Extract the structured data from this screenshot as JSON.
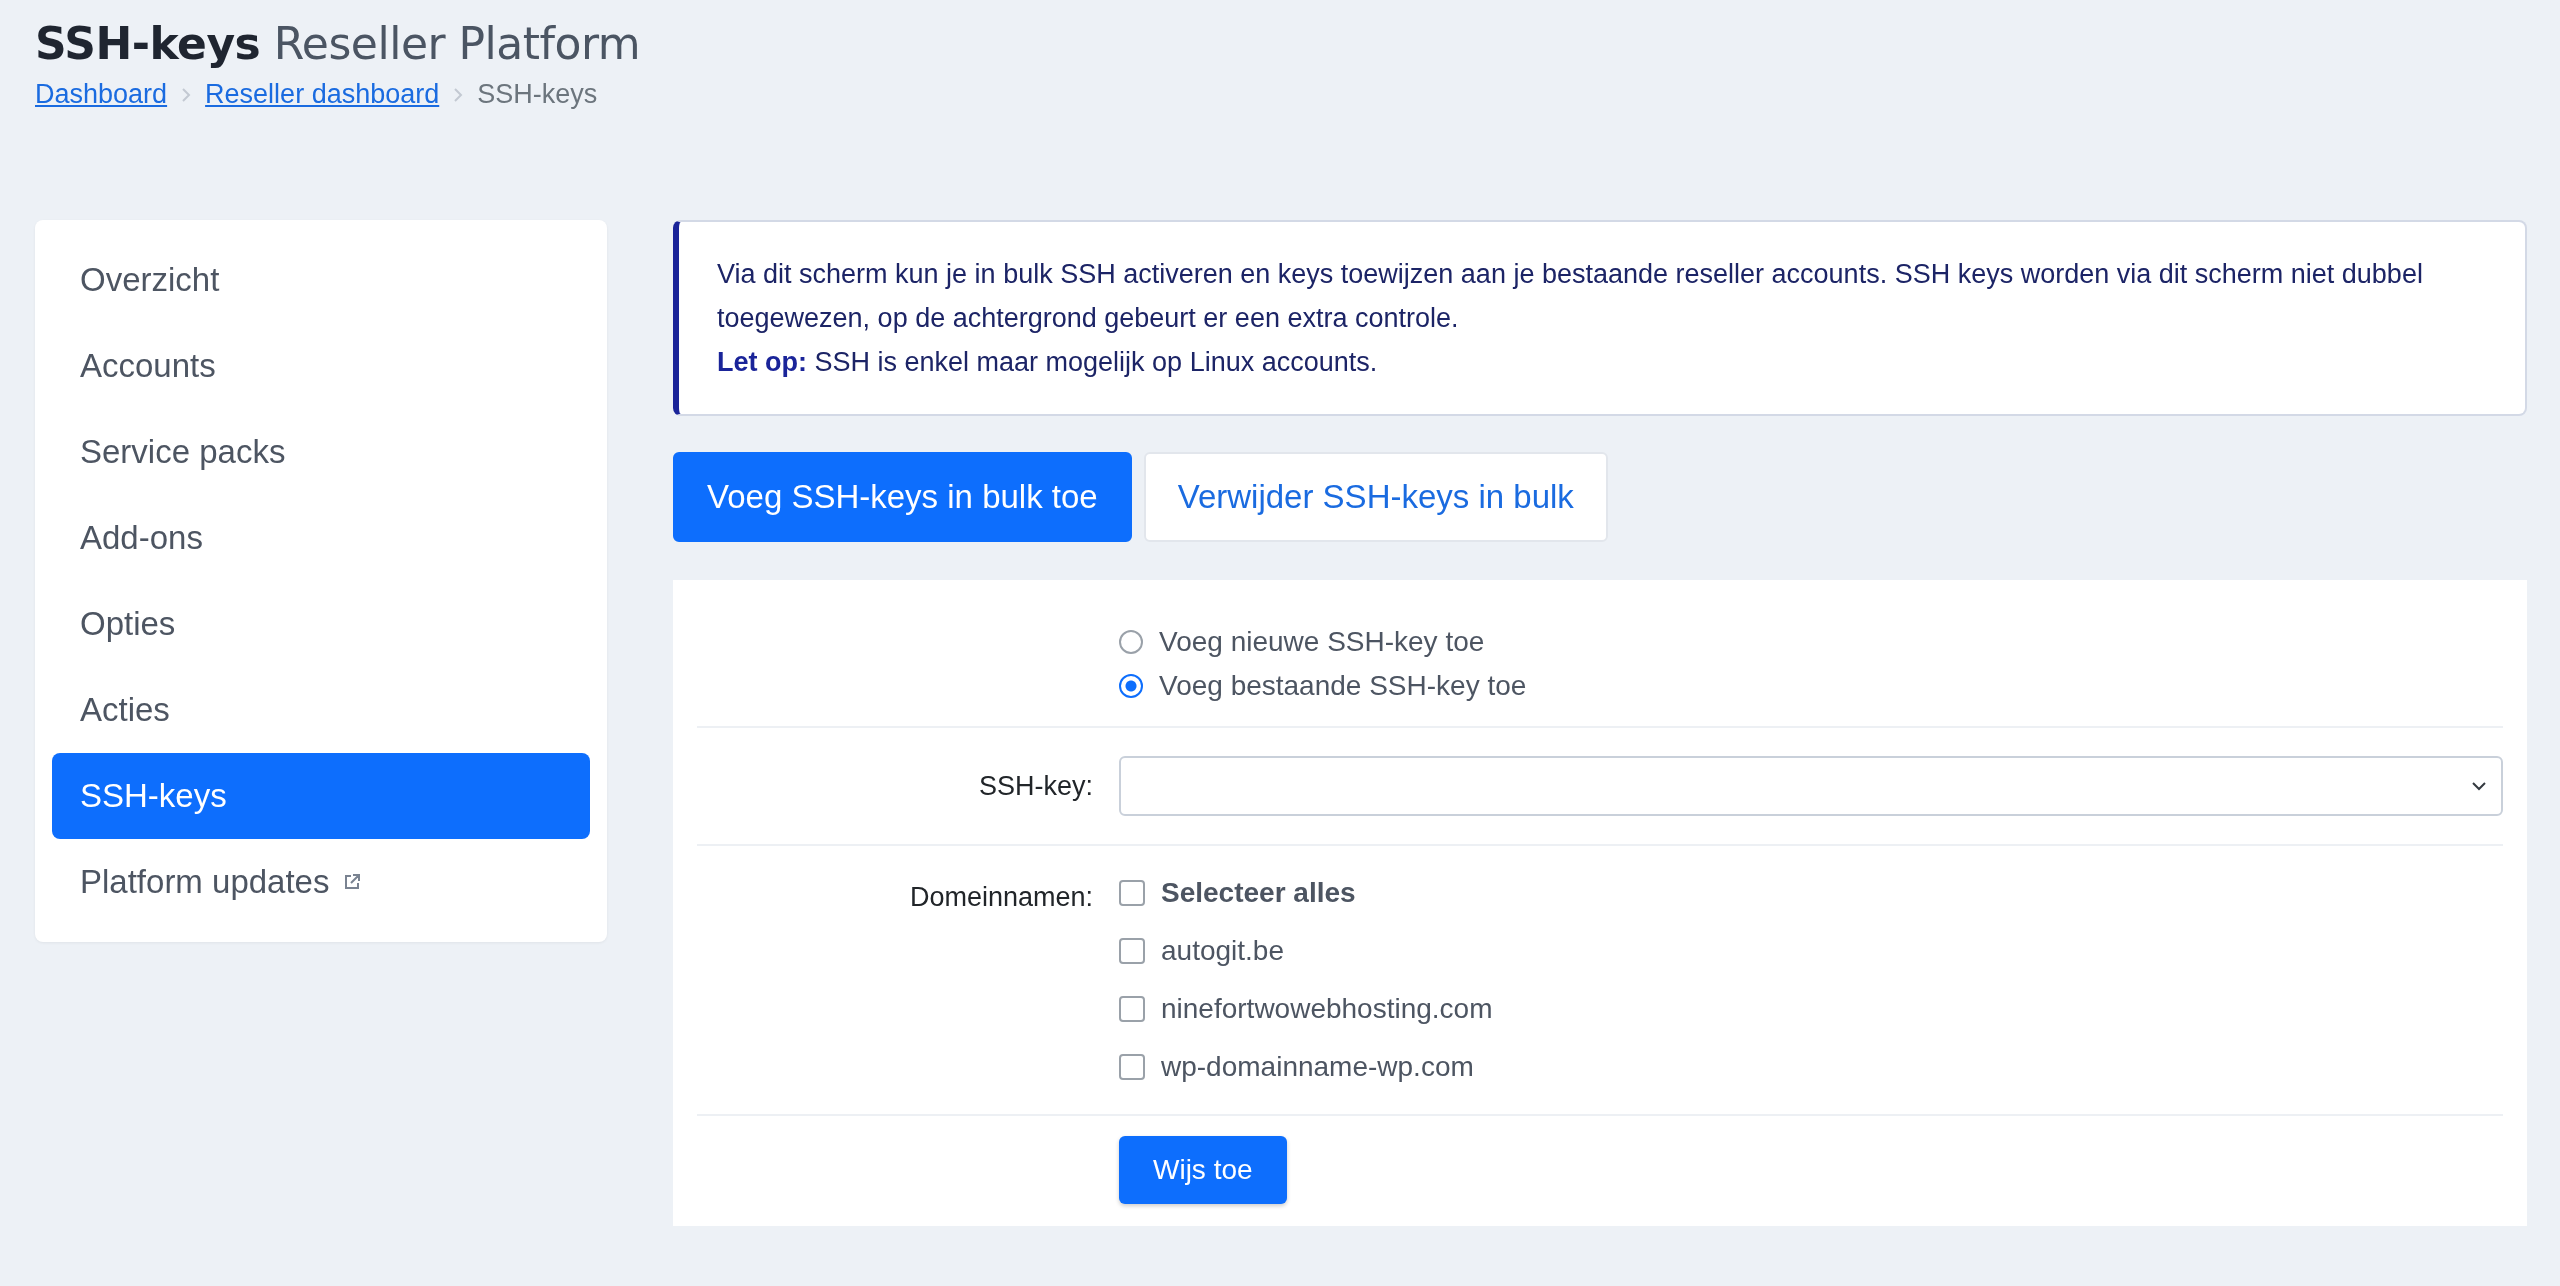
{
  "header": {
    "title_bold": "SSH-keys",
    "title_rest": "Reseller Platform"
  },
  "breadcrumb": [
    {
      "label": "Dashboard",
      "link": true
    },
    {
      "label": "Reseller dashboard",
      "link": true
    },
    {
      "label": "SSH-keys",
      "link": false
    }
  ],
  "sidebar": {
    "items": [
      {
        "label": "Overzicht",
        "selected": false,
        "external": false
      },
      {
        "label": "Accounts",
        "selected": false,
        "external": false
      },
      {
        "label": "Service packs",
        "selected": false,
        "external": false
      },
      {
        "label": "Add-ons",
        "selected": false,
        "external": false
      },
      {
        "label": "Opties",
        "selected": false,
        "external": false
      },
      {
        "label": "Acties",
        "selected": false,
        "external": false
      },
      {
        "label": "SSH-keys",
        "selected": true,
        "external": false
      },
      {
        "label": "Platform updates",
        "selected": false,
        "external": true
      }
    ]
  },
  "notice": {
    "text": "Via dit scherm kun je in bulk SSH activeren en keys toewijzen aan je bestaande reseller accounts. SSH keys worden via dit scherm niet dubbel toegewezen, op de achtergrond gebeurt er een extra controle.",
    "note": "**Let op:** SSH is enkel maar mogelijk op Linux accounts."
  },
  "tabs": [
    {
      "label": "Voeg SSH-keys in bulk toe",
      "selected": true
    },
    {
      "label": "Verwijder SSH-keys in bulk",
      "selected": false
    }
  ],
  "form": {
    "mode_options": [
      {
        "label": "Voeg nieuwe SSH-key toe",
        "selected": false
      },
      {
        "label": "Voeg bestaande SSH-key toe",
        "selected": true
      }
    ],
    "ssh_key_label": "SSH-key:",
    "domains_label": "Domeinnamen:",
    "domains": [
      {
        "label": "Selecteer alles",
        "kind": "select_all",
        "checked": false
      },
      {
        "label": "autogit.be",
        "kind": "domain",
        "checked": false
      },
      {
        "label": "ninefortwowebhosting.com",
        "kind": "domain",
        "checked": false
      },
      {
        "label": "wp-domainname-wp.com",
        "kind": "domain",
        "checked": false
      }
    ],
    "submit": "Wijs toe"
  }
}
